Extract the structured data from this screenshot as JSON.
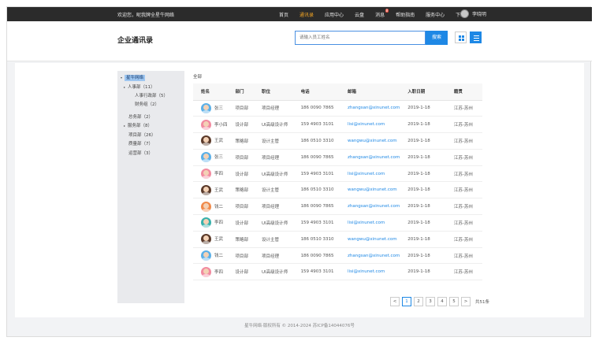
{
  "topbar": {
    "welcome": "欢迎您，昵我牌全星牛网络",
    "nav": [
      {
        "label": "首页",
        "active": false,
        "badge": ""
      },
      {
        "label": "通讯录",
        "active": true,
        "badge": ""
      },
      {
        "label": "应用中心",
        "active": false,
        "badge": ""
      },
      {
        "label": "云盘",
        "active": false,
        "badge": ""
      },
      {
        "label": "消息",
        "active": false,
        "badge": "8"
      },
      {
        "label": "帮助指南",
        "active": false,
        "badge": ""
      },
      {
        "label": "服务中心",
        "active": false,
        "badge": ""
      },
      {
        "label": "下载",
        "active": false,
        "badge": ""
      }
    ],
    "username": "李晓明"
  },
  "header": {
    "title": "企业通讯录",
    "search_placeholder": "请输入员工姓名",
    "search_button": "搜索"
  },
  "tree": {
    "root": "星牛网络",
    "items": [
      {
        "label": "人事部（11）",
        "caret": "▸"
      },
      {
        "label": "人事行政部（5）",
        "caret": ""
      },
      {
        "label": "财务组（2）",
        "caret": ""
      },
      {
        "label": "总务部（2）",
        "caret": ""
      },
      {
        "label": "服务部（8）",
        "caret": "▸"
      },
      {
        "label": "项目部（26）",
        "caret": ""
      },
      {
        "label": "质量部（7）",
        "caret": ""
      },
      {
        "label": "运营部（3）",
        "caret": ""
      }
    ]
  },
  "breadcrumb": "全部",
  "table": {
    "headers": [
      "姓名",
      "部门",
      "职位",
      "电话",
      "邮箱",
      "入职日期",
      "籍贯"
    ],
    "rows": [
      {
        "name": "张三",
        "dept": "项目部",
        "title": "项目经理",
        "phone": "186 0090 7865",
        "email": "zhangsan@xinunet.com",
        "date": "2019-1-18",
        "origin": "江苏-苏州",
        "avatar": "blue"
      },
      {
        "name": "李小四",
        "dept": "设计部",
        "title": "UI高级设计师",
        "phone": "159 4903 3101",
        "email": "lisi@xinunet.com",
        "date": "2019-1-18",
        "origin": "江苏-苏州",
        "avatar": "pink"
      },
      {
        "name": "王武",
        "dept": "策略部",
        "title": "设计主管",
        "phone": "186 0510 3310",
        "email": "wangwu@xinunet.com",
        "date": "2019-1-18",
        "origin": "江苏-苏州",
        "avatar": "dark"
      },
      {
        "name": "张三",
        "dept": "项目部",
        "title": "项目经理",
        "phone": "186 0090 7865",
        "email": "zhangsan@xinunet.com",
        "date": "2019-1-18",
        "origin": "江苏-苏州",
        "avatar": "blue"
      },
      {
        "name": "李四",
        "dept": "设计部",
        "title": "UI高级设计师",
        "phone": "159 4903 3101",
        "email": "lisi@xinunet.com",
        "date": "2019-1-18",
        "origin": "江苏-苏州",
        "avatar": "pink"
      },
      {
        "name": "王武",
        "dept": "策略部",
        "title": "设计主管",
        "phone": "186 0510 3310",
        "email": "wangwu@xinunet.com",
        "date": "2019-1-18",
        "origin": "江苏-苏州",
        "avatar": "dark"
      },
      {
        "name": "钱二",
        "dept": "项目部",
        "title": "项目经理",
        "phone": "186 0090 7865",
        "email": "zhangsan@xinunet.com",
        "date": "2019-1-18",
        "origin": "江苏-苏州",
        "avatar": "orange"
      },
      {
        "name": "李四",
        "dept": "设计部",
        "title": "UI高级设计师",
        "phone": "159 4903 3101",
        "email": "lisi@xinunet.com",
        "date": "2019-1-18",
        "origin": "江苏-苏州",
        "avatar": "teal"
      },
      {
        "name": "王武",
        "dept": "策略部",
        "title": "设计主管",
        "phone": "186 0510 3310",
        "email": "wangwu@xinunet.com",
        "date": "2019-1-18",
        "origin": "江苏-苏州",
        "avatar": "dark"
      },
      {
        "name": "钱二",
        "dept": "项目部",
        "title": "项目经理",
        "phone": "186 0090 7865",
        "email": "zhangsan@xinunet.com",
        "date": "2019-1-18",
        "origin": "江苏-苏州",
        "avatar": "blue"
      },
      {
        "name": "李四",
        "dept": "设计部",
        "title": "UI高级设计师",
        "phone": "159 4903 3101",
        "email": "lisi@xinunet.com",
        "date": "2019-1-18",
        "origin": "江苏-苏州",
        "avatar": "pink"
      }
    ]
  },
  "pagination": {
    "prev": "<",
    "pages": [
      "1",
      "2",
      "3",
      "4",
      "5"
    ],
    "active": "1",
    "next": ">",
    "total": "共51条"
  },
  "footer": "星牛网络·版权所有 © 2014-2024 苏ICP备14044076号"
}
